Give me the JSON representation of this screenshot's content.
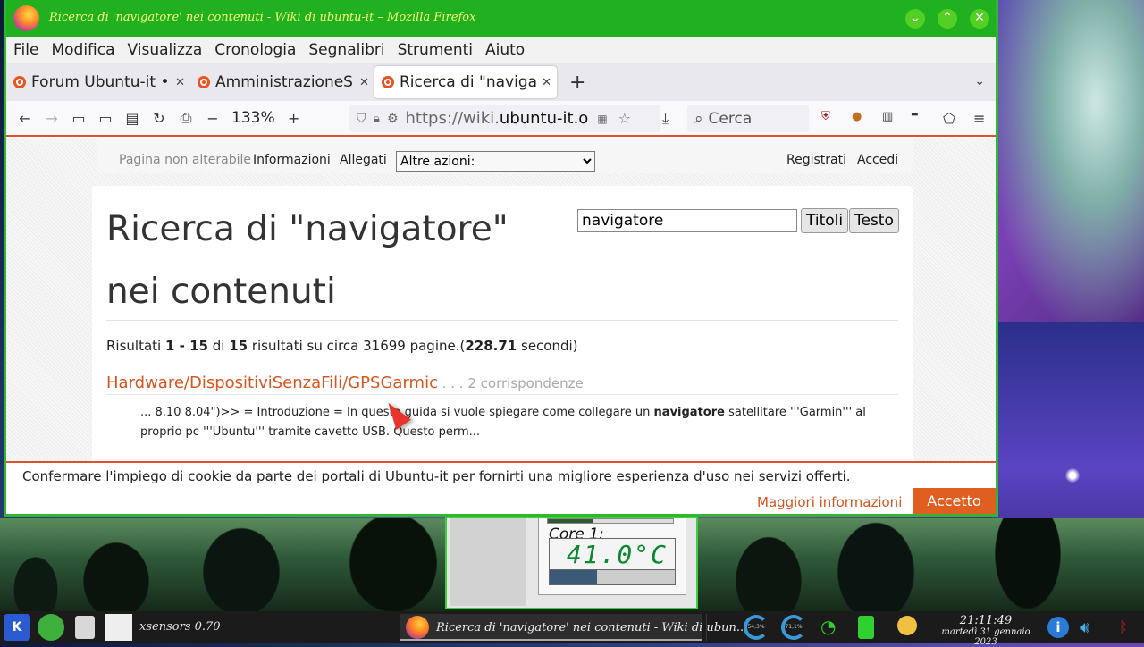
{
  "window": {
    "title": "Ricerca di 'navigatore' nei contenuti - Wiki di ubuntu-it – Mozilla Firefox"
  },
  "menu": [
    "File",
    "Modifica",
    "Visualizza",
    "Cronologia",
    "Segnalibri",
    "Strumenti",
    "Aiuto"
  ],
  "tabs": [
    {
      "label": "Forum Ubuntu-it • I"
    },
    {
      "label": "AmministrazioneSis"
    },
    {
      "label": "Ricerca di \"navigat"
    }
  ],
  "nav": {
    "zoom": "133%",
    "url_prefix": "https://wiki.",
    "url_host": "ubuntu-it.o",
    "search_placeholder": "Cerca"
  },
  "wiki": {
    "not_editable": "Pagina non alterabile",
    "info": "Informazioni",
    "attachments": "Allegati",
    "more_actions": "Altre azioni:",
    "register": "Registrati",
    "login": "Accedi"
  },
  "search": {
    "heading": "Ricerca di \"navigatore\" nei contenuti",
    "query": "navigatore",
    "titles_button": "Titoli",
    "text_button": "Testo"
  },
  "results": {
    "p1": "Risultati ",
    "range": "1 - 15",
    "p2": " di ",
    "total": "15",
    "p3": " risultati su circa 31699 pagine.(",
    "time": "228.71",
    "p4": " secondi)",
    "hit_title": "Hardware/DispositiviSenzaFili/GPSGarmic",
    "hit_count": " . . . 2 corrispondenze",
    "snippet_a": "... 8.10 8.04\")>> = Introduzione = In questa guida si vuole spiegare come collegare un ",
    "snippet_bold": "navigatore",
    "snippet_b": " satellitare '''Garmin''' al proprio pc '''Ubuntu''' tramite cavetto USB. Questo perm..."
  },
  "cookie": {
    "message": "Confermare l'impiego di cookie da parte dei portali di Ubuntu-it per fornirti una migliore esperienza d'uso nei servizi offerti.",
    "more": "Maggiori informazioni",
    "accept": "Accetto"
  },
  "xsensors": {
    "label": "Core 1:",
    "value": "41.0°C",
    "level": 0.38
  },
  "taskbar": {
    "xsensors": "xsensors 0.70",
    "firefox_item": "Ricerca di 'navigatore' nei contenuti - Wiki di ubun...",
    "cpu1": "54,3%",
    "cpu2": "71,1%",
    "time": "21:11:49",
    "date": "martedì 31 gennaio 2023"
  }
}
